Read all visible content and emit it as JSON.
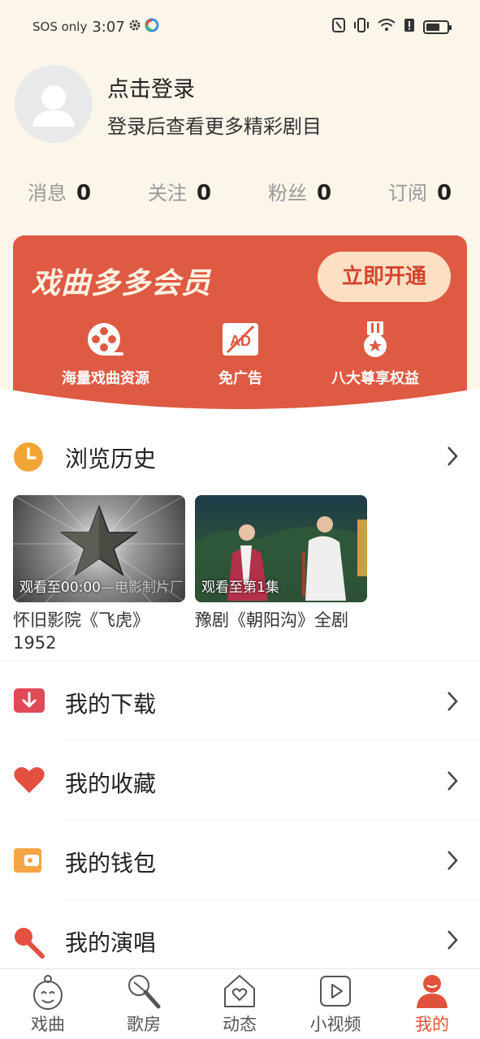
{
  "status_bar": {
    "carrier": "SOS only",
    "time": "3:07"
  },
  "profile": {
    "login_title": "点击登录",
    "login_subtitle": "登录后查看更多精彩剧目"
  },
  "stats": [
    {
      "label": "消息",
      "value": "0"
    },
    {
      "label": "关注",
      "value": "0"
    },
    {
      "label": "粉丝",
      "value": "0"
    },
    {
      "label": "订阅",
      "value": "0"
    }
  ],
  "vip": {
    "title": "戏曲多多会员",
    "cta": "立即开通",
    "perks": [
      {
        "label": "海量戏曲资源",
        "icon": "film-reel-icon"
      },
      {
        "label": "免广告",
        "icon": "no-ad-icon"
      },
      {
        "label": "八大尊享权益",
        "icon": "medal-icon"
      }
    ],
    "accent": "#df5a43"
  },
  "history": {
    "title": "浏览历史",
    "items": [
      {
        "progress": "观看至00:00",
        "overlay_extra": "—电影制片厂",
        "title": "怀旧影院《飞虎》1952"
      },
      {
        "progress": "观看至第1集",
        "title": "豫剧《朝阳沟》全剧"
      }
    ]
  },
  "menu": [
    {
      "label": "我的下载",
      "icon": "download-icon"
    },
    {
      "label": "我的收藏",
      "icon": "heart-icon"
    },
    {
      "label": "我的钱包",
      "icon": "wallet-icon"
    },
    {
      "label": "我的演唱",
      "icon": "microphone-icon"
    }
  ],
  "tabs": [
    {
      "label": "戏曲",
      "icon": "opera-icon"
    },
    {
      "label": "歌房",
      "icon": "microphone-icon"
    },
    {
      "label": "动态",
      "icon": "home-heart-icon"
    },
    {
      "label": "小视频",
      "icon": "play-icon"
    },
    {
      "label": "我的",
      "icon": "person-icon",
      "active": true
    }
  ]
}
